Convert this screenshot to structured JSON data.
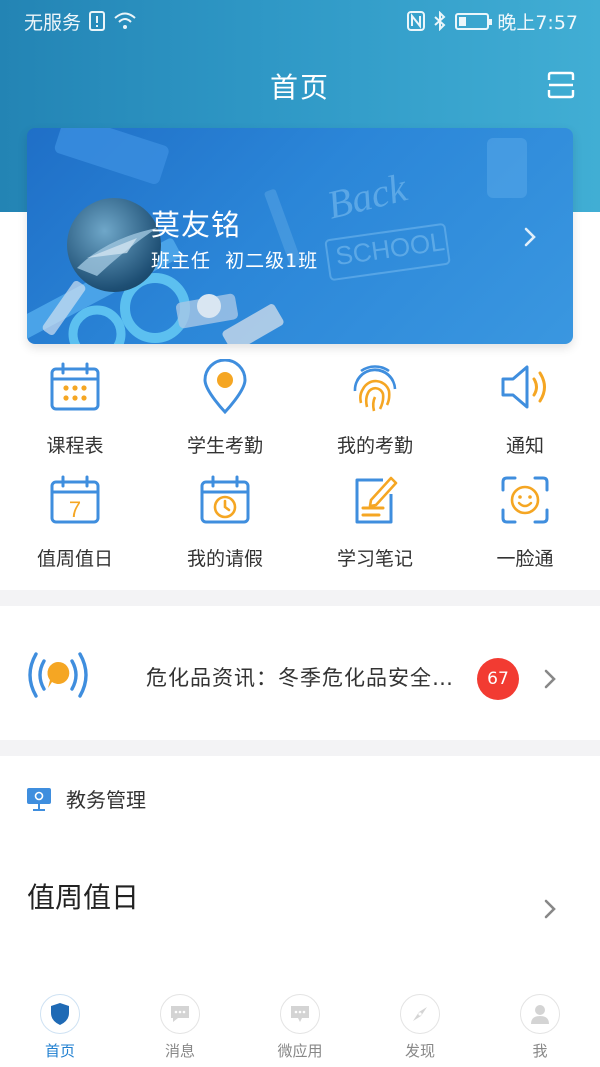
{
  "status_bar": {
    "carrier": "无服务",
    "time": "晚上7:57"
  },
  "header": {
    "title": "首页"
  },
  "profile": {
    "name": "莫友铭",
    "role": "班主任",
    "class_name": "初二级1班"
  },
  "grid": {
    "items": [
      {
        "label": "课程表",
        "icon": "calendar-grid-icon"
      },
      {
        "label": "学生考勤",
        "icon": "location-pin-icon"
      },
      {
        "label": "我的考勤",
        "icon": "fingerprint-icon"
      },
      {
        "label": "通知",
        "icon": "speaker-icon"
      },
      {
        "label": "值周值日",
        "icon": "calendar-seven-icon"
      },
      {
        "label": "我的请假",
        "icon": "calendar-clock-icon"
      },
      {
        "label": "学习笔记",
        "icon": "note-pencil-icon"
      },
      {
        "label": "一脸通",
        "icon": "face-scan-icon"
      }
    ]
  },
  "news": {
    "text": "危化品资讯：冬季危化品安全…",
    "badge": "67"
  },
  "section": {
    "title": "教务管理"
  },
  "duty": {
    "title": "值周值日"
  },
  "tabbar": {
    "tabs": [
      {
        "label": "首页",
        "icon": "shield-icon",
        "active": true
      },
      {
        "label": "消息",
        "icon": "chat-bubble-icon"
      },
      {
        "label": "微应用",
        "icon": "chat-dots-icon"
      },
      {
        "label": "发现",
        "icon": "compass-icon"
      },
      {
        "label": "我",
        "icon": "person-icon"
      }
    ]
  },
  "colors": {
    "accent_blue": "#3f8ede",
    "accent_orange": "#f5a623",
    "badge_red": "#f23b32",
    "header_blue": "#2384b4"
  }
}
